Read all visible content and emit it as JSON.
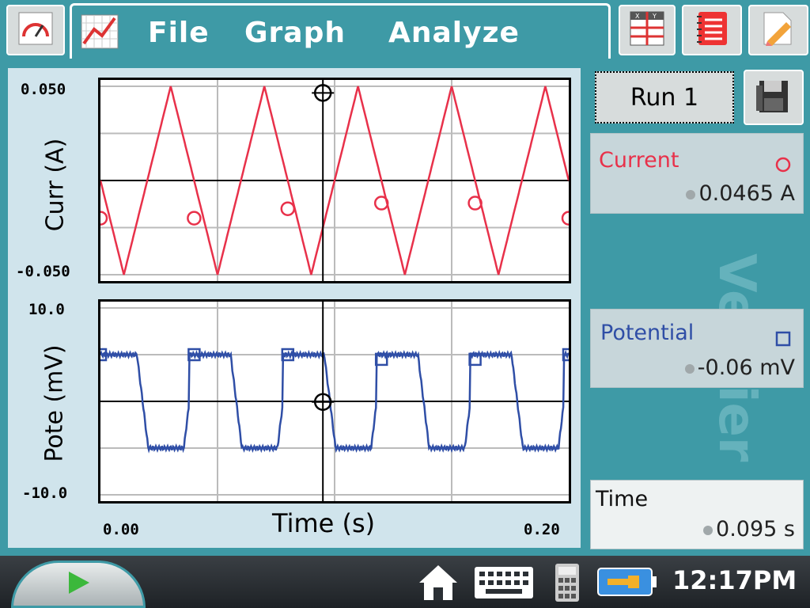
{
  "menu": {
    "file": "File",
    "graph": "Graph",
    "analyze": "Analyze"
  },
  "run": {
    "label": "Run 1"
  },
  "meters": {
    "current": {
      "name": "Current",
      "value": "0.0465 A",
      "color": "#e8314a"
    },
    "potential": {
      "name": "Potential",
      "value": "-0.06 mV",
      "color": "#2f4ea6"
    },
    "time": {
      "name": "Time",
      "value": "0.095 s"
    }
  },
  "chart_data": [
    {
      "type": "line",
      "ylabel": "Curr (A)",
      "ylim": [
        -0.05,
        0.05
      ],
      "yticks": [
        "0.050",
        "-0.050"
      ],
      "x_range": [
        0.0,
        0.2
      ],
      "series": [
        {
          "name": "Current",
          "color": "#e8314a",
          "shape": "triangle",
          "period": 0.04,
          "amplitude": 0.05
        }
      ],
      "markers": [
        {
          "x": 0,
          "y": -0.02
        },
        {
          "x": 0.04,
          "y": -0.02
        },
        {
          "x": 0.08,
          "y": -0.015
        },
        {
          "x": 0.12,
          "y": -0.012
        },
        {
          "x": 0.16,
          "y": -0.012
        },
        {
          "x": 0.2,
          "y": -0.02
        }
      ],
      "cursor": {
        "x": 0.095,
        "y": 0.0465
      }
    },
    {
      "type": "line",
      "ylabel": "Pote (mV)",
      "ylim": [
        -10,
        10
      ],
      "yticks": [
        "10.0",
        "-10.0"
      ],
      "x_range": [
        0.0,
        0.2
      ],
      "series": [
        {
          "name": "Potential",
          "color": "#2f4ea6",
          "shape": "square",
          "period": 0.04,
          "high": 5,
          "low": -5
        }
      ],
      "markers": [
        {
          "x": 0,
          "y": 5
        },
        {
          "x": 0.04,
          "y": 5
        },
        {
          "x": 0.08,
          "y": 5
        },
        {
          "x": 0.12,
          "y": 4.5
        },
        {
          "x": 0.16,
          "y": 4.5
        },
        {
          "x": 0.2,
          "y": 5
        }
      ],
      "cursor": {
        "x": 0.095,
        "y": -0.06
      }
    }
  ],
  "xaxis": {
    "label": "Time (s)",
    "min_label": "0.00",
    "max_label": "0.20"
  },
  "taskbar": {
    "clock": "12:17PM"
  },
  "watermark": "Vernier"
}
